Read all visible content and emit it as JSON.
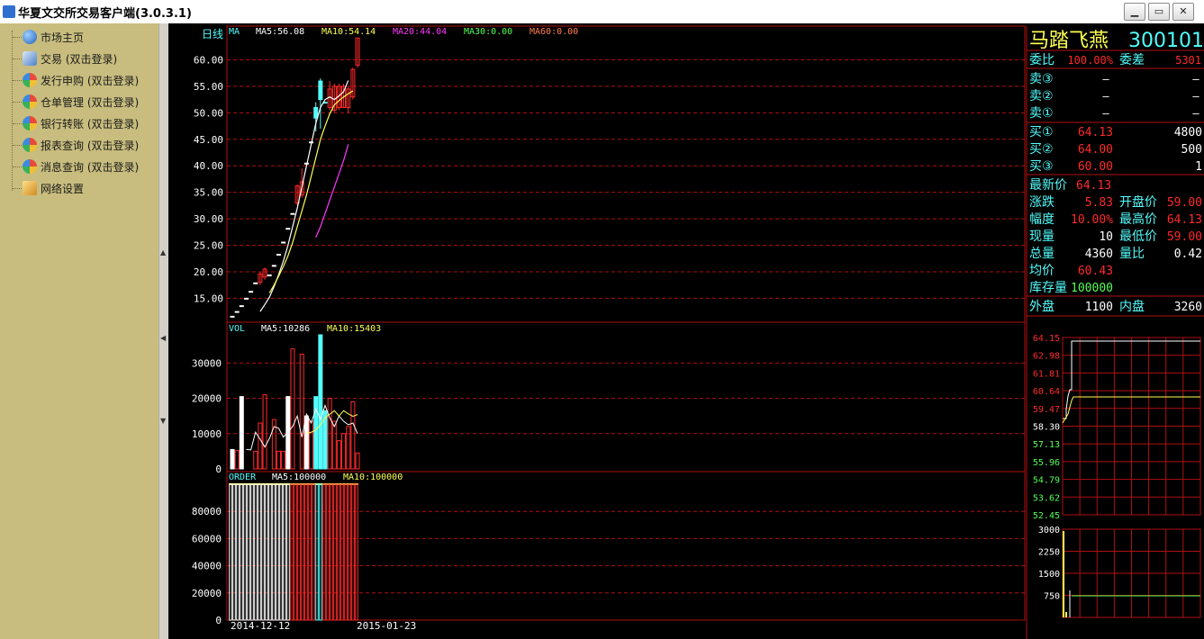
{
  "window": {
    "title": "华夏文交所交易客户端(3.0.3.1)",
    "btn_min": "▁",
    "btn_max": "▭",
    "btn_close": "✕"
  },
  "sidebar": {
    "items": [
      {
        "label": "市场主页",
        "icon": "globe-icon",
        "color": "#3a7bd5"
      },
      {
        "label": "交易 (双击登录)",
        "icon": "users-icon",
        "color": "#4a7fc8"
      },
      {
        "label": "发行申购 (双击登录)",
        "icon": "house-icon",
        "color": "#e8a030"
      },
      {
        "label": "仓单管理 (双击登录)",
        "icon": "house-icon",
        "color": "#e8a030"
      },
      {
        "label": "银行转账 (双击登录)",
        "icon": "house-icon",
        "color": "#e8a030"
      },
      {
        "label": "报表查询 (双击登录)",
        "icon": "house-icon",
        "color": "#e8a030"
      },
      {
        "label": "消息查询 (双击登录)",
        "icon": "house-icon",
        "color": "#e8a030"
      },
      {
        "label": "网络设置",
        "icon": "network-icon",
        "color": "#d9a040"
      }
    ]
  },
  "chart": {
    "period": "日线",
    "legend_ma": [
      "MA",
      "MA5:56.08",
      "MA10:54.14",
      "MA20:44.04",
      "MA30:0.00",
      "MA60:0.00"
    ],
    "legend_vol": [
      "VOL",
      "MA5:10286",
      "MA10:15403"
    ],
    "legend_order": [
      "ORDER",
      "MA5:100000",
      "MA10:100000"
    ],
    "date_start": "2014-12-12",
    "date_end": "2015-01-23",
    "colors": {
      "up": "#ff2a2a",
      "down": "#54fcfc",
      "ma5": "#ffffff",
      "ma10": "#ffff54",
      "ma20": "#ff36ff",
      "ma30": "#54ff54",
      "ma60": "#ff7f50",
      "grid": "#b01010"
    }
  },
  "chart_data": [
    {
      "type": "candlestick",
      "title": "日线",
      "y_ticks": [
        "60.00",
        "55.00",
        "50.00",
        "45.00",
        "40.00",
        "35.00",
        "30.00",
        "25.00",
        "20.00",
        "15.00"
      ],
      "ylim": [
        11.5,
        64.5
      ],
      "series": [
        {
          "name": "MA5",
          "values": [
            12.5,
            13.8,
            15.2,
            17.2,
            19.5,
            22,
            25,
            28.5,
            32,
            36,
            40,
            44,
            48,
            51,
            52.5,
            53,
            52.5,
            53.2,
            54,
            56.1
          ]
        },
        {
          "name": "MA10",
          "values": [
            16,
            17.5,
            19.2,
            21,
            23,
            25.5,
            28.5,
            31.5,
            34.5,
            38,
            41.5,
            45,
            47.5,
            49.8,
            51.5,
            52.3,
            53,
            53.6,
            54.14
          ]
        },
        {
          "name": "MA20",
          "values": [
            26.5,
            28.5,
            31,
            33.5,
            36,
            38.5,
            41,
            44.04
          ]
        }
      ],
      "candles": [
        {
          "o": 11.6,
          "c": 11.6,
          "h": 11.6,
          "l": 11.6
        },
        {
          "o": 12.5,
          "c": 12.5,
          "h": 12.5,
          "l": 12.5
        },
        {
          "o": 13.6,
          "c": 13.6,
          "h": 13.6,
          "l": 13.6
        },
        {
          "o": 15,
          "c": 15,
          "h": 15,
          "l": 15
        },
        {
          "o": 16.3,
          "c": 16.3,
          "h": 16.3,
          "l": 16.3
        },
        {
          "o": 17.9,
          "c": 17.9,
          "h": 17.9,
          "l": 17.9
        },
        {
          "o": 18,
          "c": 19.6,
          "h": 20,
          "l": 17.5
        },
        {
          "o": 19,
          "c": 20.5,
          "h": 20.8,
          "l": 18.5
        },
        {
          "o": 19.4,
          "c": 19.4,
          "h": 19.4,
          "l": 19.4
        },
        {
          "o": 21.2,
          "c": 21.2,
          "h": 21.2,
          "l": 21.2
        },
        {
          "o": 23.3,
          "c": 23.3,
          "h": 23.3,
          "l": 23.3
        },
        {
          "o": 25.6,
          "c": 25.6,
          "h": 25.6,
          "l": 25.6
        },
        {
          "o": 28.2,
          "c": 28.2,
          "h": 28.2,
          "l": 28.2
        },
        {
          "o": 31,
          "c": 31,
          "h": 31,
          "l": 31
        },
        {
          "o": 33,
          "c": 36.2,
          "h": 36.5,
          "l": 32.5
        },
        {
          "o": 34.5,
          "c": 37,
          "h": 39.5,
          "l": 34
        },
        {
          "o": 40.5,
          "c": 40.5,
          "h": 40.5,
          "l": 40.5
        },
        {
          "o": 44.5,
          "c": 44.5,
          "h": 44.5,
          "l": 44.5
        },
        {
          "o": 49,
          "c": 51,
          "h": 52,
          "l": 46.5
        },
        {
          "o": 56,
          "c": 52.5,
          "h": 56.5,
          "l": 47
        },
        {
          "o": 52,
          "c": 52,
          "h": 52,
          "l": 52
        },
        {
          "o": 51,
          "c": 54.5,
          "h": 56,
          "l": 50.5
        },
        {
          "o": 50.5,
          "c": 55,
          "h": 55.5,
          "l": 50
        },
        {
          "o": 51,
          "c": 55,
          "h": 55.5,
          "l": 50.5
        },
        {
          "o": 51,
          "c": 55,
          "h": 55.5,
          "l": 51
        },
        {
          "o": 51,
          "c": 54.5,
          "h": 55,
          "l": 50
        },
        {
          "o": 53,
          "c": 58.2,
          "h": 58.5,
          "l": 52.5
        },
        {
          "o": 59,
          "c": 64.13,
          "h": 64.13,
          "l": 58.5
        }
      ]
    },
    {
      "type": "bar",
      "title": "VOL",
      "y_ticks": [
        "30000",
        "20000",
        "10000",
        "0"
      ],
      "ylim": [
        0,
        38000
      ],
      "values": [
        5500,
        5200,
        20500,
        0,
        0,
        5000,
        13000,
        21000,
        0,
        14000,
        5000,
        5000,
        20500,
        34000,
        0,
        32500,
        15000,
        13500,
        20500,
        38000,
        16500,
        20000,
        13500,
        8000,
        10000,
        12000,
        19000,
        4500
      ],
      "colors": [
        "down",
        "up",
        "down",
        "up",
        "up",
        "up",
        "up",
        "up",
        "down",
        "up",
        "up",
        "up",
        "down",
        "up",
        "up",
        "up",
        "down",
        "up",
        "down",
        "down",
        "down",
        "up",
        "up",
        "up",
        "up",
        "up",
        "up",
        "up"
      ],
      "series": [
        {
          "name": "MA5",
          "values": [
            5500,
            5400,
            10400,
            8400,
            6200,
            8600,
            12000,
            11500,
            9000,
            10500,
            12000,
            15000,
            9000,
            15500,
            13000,
            17000,
            14000,
            18000,
            14500,
            12000,
            15000,
            13500,
            12500,
            13000,
            10000
          ]
        },
        {
          "name": "MA10",
          "values": [
            10000,
            10400,
            11000,
            12500,
            14500,
            15500,
            16500,
            15000,
            16500,
            15600,
            14900,
            15403
          ]
        }
      ]
    },
    {
      "type": "bar",
      "title": "ORDER",
      "y_ticks": [
        "80000",
        "60000",
        "40000",
        "20000",
        "0"
      ],
      "ylim": [
        0,
        100000
      ],
      "values_per_bar": 100000,
      "bar_count": 36
    }
  ],
  "quote": {
    "name": "马踏飞燕",
    "code": "300101",
    "wei_bi_label": "委比",
    "wei_bi": "100.00%",
    "wei_cha_label": "委差",
    "wei_cha": "5301",
    "sells": [
      {
        "label": "卖③",
        "price": "—",
        "vol": "—"
      },
      {
        "label": "卖②",
        "price": "—",
        "vol": "—"
      },
      {
        "label": "卖①",
        "price": "—",
        "vol": "—"
      }
    ],
    "buys": [
      {
        "label": "买①",
        "price": "64.13",
        "vol": "4800"
      },
      {
        "label": "买②",
        "price": "64.00",
        "vol": "500"
      },
      {
        "label": "买③",
        "price": "60.00",
        "vol": "1"
      }
    ],
    "last_label": "最新价",
    "last": "64.13",
    "change_label": "涨跌",
    "change": "5.83",
    "open_label": "开盘价",
    "open": "59.00",
    "pct_label": "幅度",
    "pct": "10.00%",
    "high_label": "最高价",
    "high": "64.13",
    "curvol_label": "现量",
    "curvol": "10",
    "low_label": "最低价",
    "low": "59.00",
    "totvol_label": "总量",
    "totvol": "4360",
    "volratio_label": "量比",
    "volratio": "0.42",
    "avg_label": "均价",
    "avg": "60.43",
    "stock_label": "库存量",
    "stock": "100000",
    "outer_label": "外盘",
    "outer": "1100",
    "inner_label": "内盘",
    "inner": "3260"
  },
  "intraday": {
    "price_ticks": [
      "64.15",
      "62.98",
      "61.81",
      "60.64",
      "59.47",
      "58.30",
      "57.13",
      "55.96",
      "54.79",
      "53.62",
      "52.45"
    ],
    "vol_ticks": [
      "3000",
      "2250",
      "1500",
      "750"
    ],
    "close_line": "58.30"
  }
}
